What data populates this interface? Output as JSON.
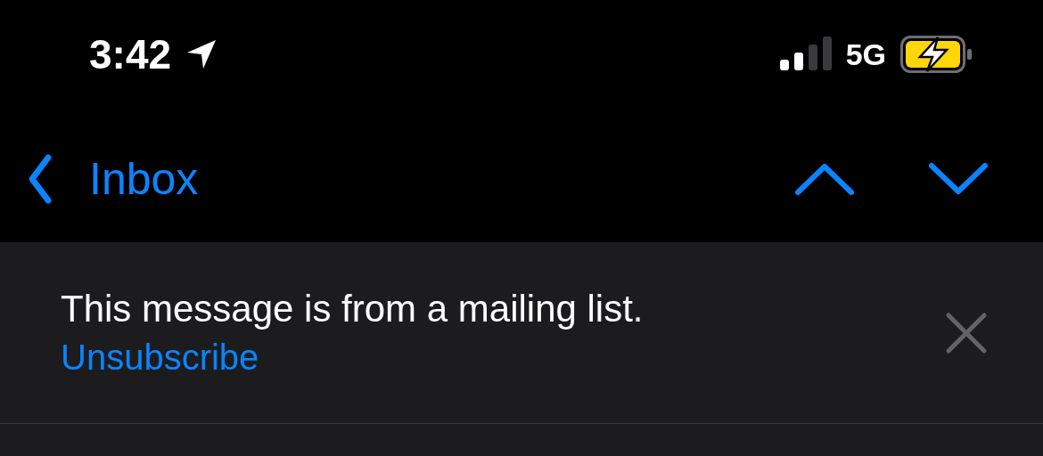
{
  "status_bar": {
    "time": "3:42",
    "network": "5G"
  },
  "nav": {
    "back_label": "Inbox"
  },
  "banner": {
    "message": "This message is from a mailing list.",
    "link": "Unsubscribe"
  }
}
